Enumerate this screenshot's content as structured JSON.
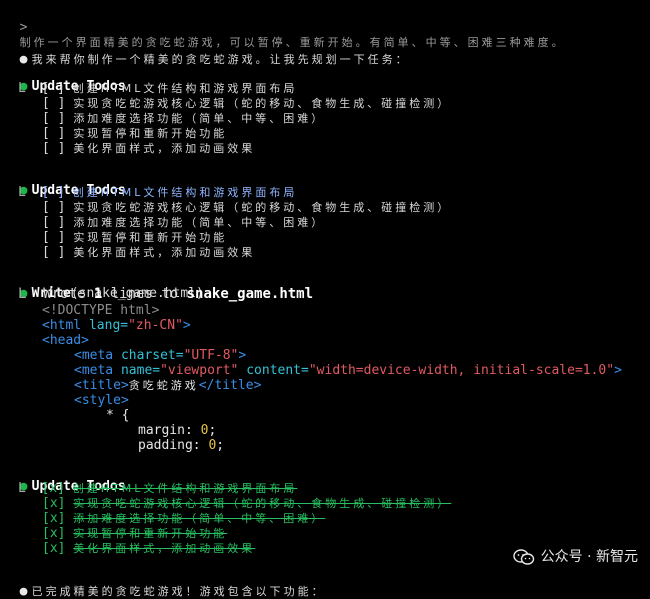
{
  "prompt": {
    "marker": ">",
    "text": "制作一个界面精美的贪吃蛇游戏，可以暂停、重新开始。有简单、中等、困难三种难度。"
  },
  "assistant_intro": "我来帮你制作一个精美的贪吃蛇游戏。让我先规划一下任务：",
  "todo_blocks": [
    {
      "title": "Update Todos",
      "items": [
        {
          "box": "[ ]",
          "text": "创建HTML文件结构和游戏界面布局"
        },
        {
          "box": "[ ]",
          "text": "实现贪吃蛇游戏核心逻辑（蛇的移动、食物生成、碰撞检测）"
        },
        {
          "box": "[ ]",
          "text": "添加难度选择功能（简单、中等、困难）"
        },
        {
          "box": "[ ]",
          "text": "实现暂停和重新开始功能"
        },
        {
          "box": "[ ]",
          "text": "美化界面样式，添加动画效果"
        }
      ]
    },
    {
      "title": "Update Todos",
      "items": [
        {
          "box": "[ ]",
          "text": "创建HTML文件结构和游戏界面布局"
        },
        {
          "box": "[ ]",
          "text": "实现贪吃蛇游戏核心逻辑（蛇的移动、食物生成、碰撞检测）"
        },
        {
          "box": "[ ]",
          "text": "添加难度选择功能（简单、中等、困难）"
        },
        {
          "box": "[ ]",
          "text": "实现暂停和重新开始功能"
        },
        {
          "box": "[ ]",
          "text": "美化界面样式，添加动画效果"
        }
      ]
    },
    {
      "title": "Update Todos",
      "items": [
        {
          "box": "[x]",
          "text": "创建HTML文件结构和游戏界面布局"
        },
        {
          "box": "[x]",
          "text": "实现贪吃蛇游戏核心逻辑（蛇的移动、食物生成、碰撞检测）"
        },
        {
          "box": "[x]",
          "text": "添加难度选择功能（简单、中等、困难）"
        },
        {
          "box": "[x]",
          "text": "实现暂停和重新开始功能"
        },
        {
          "box": "[x]",
          "text": "美化界面样式，添加动画效果"
        }
      ]
    }
  ],
  "write": {
    "tool": "Write",
    "arg": "(snake_game.html)",
    "result_prefix": "Wrote ",
    "result_count": "1",
    "result_mid": " lines to ",
    "result_file": "snake_game.html",
    "code": {
      "doctype": "<!DOCTYPE html>",
      "html_open": "<html",
      "lang_attr": " lang=",
      "lang_val": "\"zh-CN\"",
      "html_close": ">",
      "head": "<head>",
      "meta1_open": "<meta",
      "meta1_attr": " charset=",
      "meta1_val": "\"UTF-8\"",
      "meta1_close": ">",
      "meta2_open": "<meta",
      "meta2_attr1": " name=",
      "meta2_val1": "\"viewport\"",
      "meta2_attr2": " content=",
      "meta2_val2": "\"width=device-width, initial-scale=1.0\"",
      "meta2_close": ">",
      "title_open": "<title>",
      "title_text": "贪吃蛇游戏",
      "title_close": "</title>",
      "style_open": "<style>",
      "css_selector": "* {",
      "css_margin_prop": "margin: ",
      "css_margin_val": "0",
      "css_padding_prop": "padding: ",
      "css_padding_val": "0"
    }
  },
  "final_message": "已完成精美的贪吃蛇游戏！游戏包含以下功能：",
  "watermark": "公众号 · 新智元",
  "colors": {
    "background": "#000000",
    "bullet_green": "#1fb54a",
    "done_green": "#27c060",
    "active_blue": "#8fb4ff",
    "tag_blue": "#3a8ee6",
    "attr_cyan": "#36c0d6",
    "string_red": "#e05a63"
  }
}
